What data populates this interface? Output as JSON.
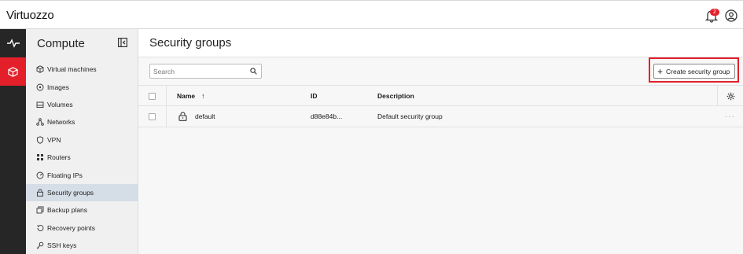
{
  "app": {
    "logo": "Virtuozzo"
  },
  "header": {
    "notifications_count": "2"
  },
  "rail": {
    "items": [
      "monitoring-icon",
      "compute-cube-icon"
    ]
  },
  "sidebar": {
    "title": "Compute",
    "items": [
      {
        "label": "Virtual machines",
        "icon": "cube-icon"
      },
      {
        "label": "Images",
        "icon": "disc-icon"
      },
      {
        "label": "Volumes",
        "icon": "drive-icon"
      },
      {
        "label": "Networks",
        "icon": "network-icon"
      },
      {
        "label": "VPN",
        "icon": "shield-icon"
      },
      {
        "label": "Routers",
        "icon": "router-icon"
      },
      {
        "label": "Floating IPs",
        "icon": "gauge-icon"
      },
      {
        "label": "Security groups",
        "icon": "lock-icon",
        "active": true
      },
      {
        "label": "Backup plans",
        "icon": "copy-icon"
      },
      {
        "label": "Recovery points",
        "icon": "recovery-icon"
      },
      {
        "label": "SSH keys",
        "icon": "key-icon"
      }
    ]
  },
  "main": {
    "title": "Security groups",
    "search_placeholder": "Search",
    "create_label": "Create security group",
    "table": {
      "headers": {
        "name": "Name",
        "id": "ID",
        "description": "Description"
      },
      "rows": [
        {
          "name": "default",
          "id": "d88e84b...",
          "description": "Default security group",
          "menu": "···"
        }
      ]
    }
  },
  "colors": {
    "accent": "#e3202a",
    "rail": "#262626",
    "active_nav": "#d5dde6"
  }
}
